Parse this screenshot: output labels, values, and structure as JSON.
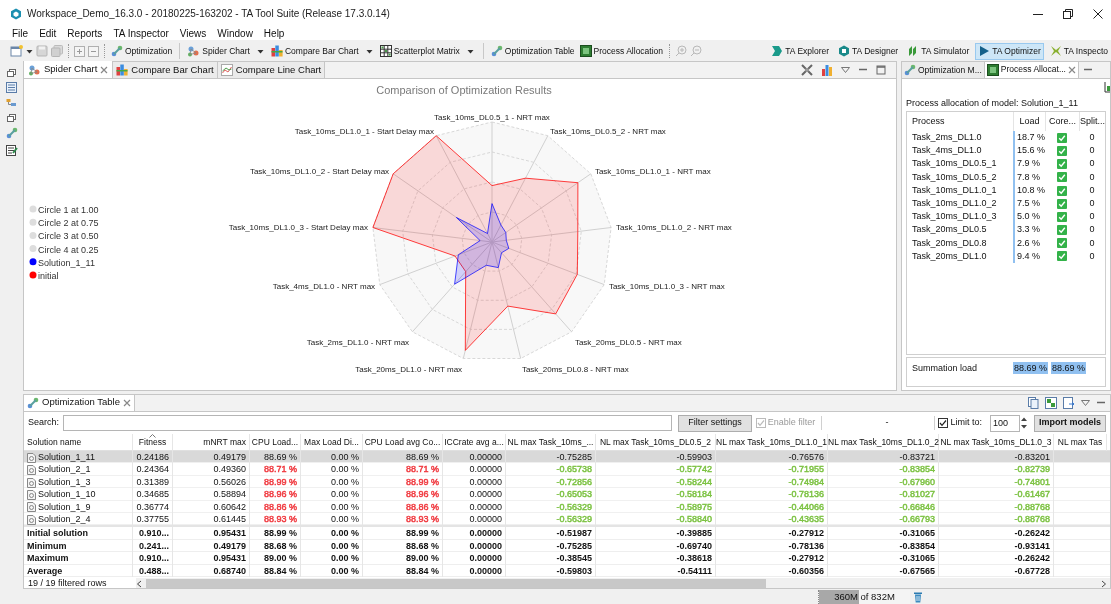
{
  "window": {
    "title": "Workspace_Demo_16.3.0 - 20180225-163202 - TA Tool Suite (Release 17.3.0.14)"
  },
  "menu": [
    "File",
    "Edit",
    "Reports",
    "TA Inspector",
    "Views",
    "Window",
    "Help"
  ],
  "toolbar": [
    {
      "label": "Optimization",
      "dropdown": false
    },
    {
      "label": "Spider Chart",
      "dropdown": true
    },
    {
      "label": "Compare Bar Chart",
      "dropdown": true
    },
    {
      "label": "Scatterplot Matrix",
      "dropdown": true
    },
    {
      "label": "Optimization Table",
      "dropdown": false
    },
    {
      "label": "Process Allocation",
      "dropdown": false
    }
  ],
  "perspectives": [
    {
      "label": "TA Explorer",
      "selected": false
    },
    {
      "label": "TA Designer",
      "selected": false
    },
    {
      "label": "TA Simulator",
      "selected": false
    },
    {
      "label": "TA Optimizer",
      "selected": true
    },
    {
      "label": "TA Inspecto",
      "selected": false
    }
  ],
  "editor": {
    "tabs": [
      {
        "label": "Spider Chart",
        "selected": true
      },
      {
        "label": "Compare Bar Chart",
        "selected": false
      },
      {
        "label": "Compare Line Chart",
        "selected": false
      }
    ],
    "chart": {
      "title": "Comparison of Optimization Results",
      "axes": [
        "Task_10ms_DL0.5_1 - NRT max",
        "Task_10ms_DL1.0_1 - Start Delay max",
        "Task_10ms_DL0.5_2 - NRT max",
        "Task_10ms_DL1.0_2 - Start Delay max",
        "Task_10ms_DL1.0_1 - NRT max",
        "Task_10ms_DL1.0_3 - Start Delay max",
        "Task_10ms_DL1.0_2 - NRT max",
        "Task_4ms_DL1.0 - NRT max",
        "Task_10ms_DL1.0_3 - NRT max",
        "Task_2ms_DL1.0 - NRT max",
        "Task_20ms_DL0.5 - NRT max",
        "Task_20ms_DL1.0 - NRT max",
        "Task_20ms_DL0.8 - NRT max"
      ],
      "legend": [
        {
          "label": "Circle 1 at 1.00",
          "color": "#dddddd"
        },
        {
          "label": "Circle 2 at 0.75",
          "color": "#dddddd"
        },
        {
          "label": "Circle 3 at 0.50",
          "color": "#dddddd"
        },
        {
          "label": "Circle 4 at 0.25",
          "color": "#dddddd"
        },
        {
          "label": "Solution_1_11",
          "color": "#0000ff"
        },
        {
          "label": "initial",
          "color": "#ff0000"
        }
      ]
    }
  },
  "process_panel": {
    "tabs": [
      {
        "label": "Optimization M...",
        "selected": false
      },
      {
        "label": "Process Allocat...",
        "selected": true
      }
    ],
    "heading": "Process allocation of model: Solution_1_11",
    "columns": [
      "Process",
      "Load",
      "Core...",
      "Split..."
    ],
    "rows": [
      {
        "process": "Task_2ms_DL1.0",
        "load": "18.7 %",
        "checked": true,
        "split": "0"
      },
      {
        "process": "Task_4ms_DL1.0",
        "load": "15.6 %",
        "checked": true,
        "split": "0"
      },
      {
        "process": "Task_10ms_DL0.5_1",
        "load": "7.9 %",
        "checked": true,
        "split": "0"
      },
      {
        "process": "Task_10ms_DL0.5_2",
        "load": "7.8 %",
        "checked": true,
        "split": "0"
      },
      {
        "process": "Task_10ms_DL1.0_1",
        "load": "10.8 %",
        "checked": true,
        "split": "0"
      },
      {
        "process": "Task_10ms_DL1.0_2",
        "load": "7.5 %",
        "checked": true,
        "split": "0"
      },
      {
        "process": "Task_10ms_DL1.0_3",
        "load": "5.0 %",
        "checked": true,
        "split": "0"
      },
      {
        "process": "Task_20ms_DL0.5",
        "load": "3.3 %",
        "checked": true,
        "split": "0"
      },
      {
        "process": "Task_20ms_DL0.8",
        "load": "2.6 %",
        "checked": true,
        "split": "0"
      },
      {
        "process": "Task_20ms_DL1.0",
        "load": "9.4 %",
        "checked": true,
        "split": "0"
      }
    ],
    "summary": {
      "label": "Summation load",
      "values": [
        "88.69 %",
        "88.69 %"
      ]
    }
  },
  "table_panel": {
    "tab": "Optimization Table",
    "search_label": "Search:",
    "filter_button": "Filter settings",
    "enable_filter": {
      "label": "Enable filter",
      "checked": true,
      "disabled": true
    },
    "filter_status": "-",
    "limit": {
      "label": "Limit to:",
      "checked": true,
      "value": "100"
    },
    "import_button": "Import models",
    "columns": [
      "Solution name",
      "Fitness",
      "mNRT max",
      "CPU Load...",
      "Max Load Di...",
      "CPU Load avg Co...",
      "ICCrate avg a...",
      "NL max Task_10ms_...",
      "NL max Task_10ms_DL0.5_2",
      "NL max Task_10ms_DL1.0_1",
      "NL max Task_10ms_DL1.0_2",
      "NL max Task_10ms_DL1.0_3",
      "NL max Tas"
    ],
    "rows": [
      {
        "selected": true,
        "cells": [
          {
            "text": "Solution_1_11"
          },
          {
            "text": "0.24186"
          },
          {
            "text": "0.49179"
          },
          {
            "text": "88.69 %"
          },
          {
            "text": "0.00 %"
          },
          {
            "text": "88.69 %"
          },
          {
            "text": "0.00000"
          },
          {
            "text": "-0.75285"
          },
          {
            "text": "-0.59903"
          },
          {
            "text": "-0.76576"
          },
          {
            "text": "-0.83721"
          },
          {
            "text": "-0.83201"
          }
        ]
      },
      {
        "selected": false,
        "cells": [
          {
            "text": "Solution_2_1"
          },
          {
            "text": "0.24364"
          },
          {
            "text": "0.49360"
          },
          {
            "text": "88.71 %",
            "color": "#f0393f"
          },
          {
            "text": "0.00 %"
          },
          {
            "text": "88.71 %",
            "color": "#f0393f"
          },
          {
            "text": "0.00000"
          },
          {
            "text": "-0.65738",
            "color": "#7cc242"
          },
          {
            "text": "-0.57742",
            "color": "#7cc242"
          },
          {
            "text": "-0.71955",
            "color": "#7cc242"
          },
          {
            "text": "-0.83854",
            "color": "#7cc242"
          },
          {
            "text": "-0.82739",
            "color": "#7cc242"
          }
        ]
      },
      {
        "selected": false,
        "cells": [
          {
            "text": "Solution_1_3"
          },
          {
            "text": "0.31389"
          },
          {
            "text": "0.56026"
          },
          {
            "text": "88.99 %",
            "color": "#f0393f"
          },
          {
            "text": "0.00 %"
          },
          {
            "text": "88.99 %",
            "color": "#f0393f"
          },
          {
            "text": "0.00000"
          },
          {
            "text": "-0.72856",
            "color": "#7cc242"
          },
          {
            "text": "-0.58244",
            "color": "#7cc242"
          },
          {
            "text": "-0.74984",
            "color": "#7cc242"
          },
          {
            "text": "-0.67960",
            "color": "#7cc242"
          },
          {
            "text": "-0.74801",
            "color": "#7cc242"
          }
        ]
      },
      {
        "selected": false,
        "cells": [
          {
            "text": "Solution_1_10"
          },
          {
            "text": "0.34685"
          },
          {
            "text": "0.58894"
          },
          {
            "text": "88.96 %",
            "color": "#f0393f"
          },
          {
            "text": "0.00 %"
          },
          {
            "text": "88.96 %",
            "color": "#f0393f"
          },
          {
            "text": "0.00000"
          },
          {
            "text": "-0.65053",
            "color": "#7cc242"
          },
          {
            "text": "-0.58184",
            "color": "#7cc242"
          },
          {
            "text": "-0.78136",
            "color": "#7cc242"
          },
          {
            "text": "-0.81027",
            "color": "#7cc242"
          },
          {
            "text": "-0.61467",
            "color": "#7cc242"
          }
        ]
      },
      {
        "selected": false,
        "cells": [
          {
            "text": "Solution_1_9"
          },
          {
            "text": "0.36774"
          },
          {
            "text": "0.60642"
          },
          {
            "text": "88.86 %",
            "color": "#f0393f"
          },
          {
            "text": "0.00 %"
          },
          {
            "text": "88.86 %",
            "color": "#f0393f"
          },
          {
            "text": "0.00000"
          },
          {
            "text": "-0.56329",
            "color": "#7cc242"
          },
          {
            "text": "-0.58975",
            "color": "#7cc242"
          },
          {
            "text": "-0.44066",
            "color": "#7cc242"
          },
          {
            "text": "-0.66846",
            "color": "#7cc242"
          },
          {
            "text": "-0.88768",
            "color": "#7cc242"
          }
        ]
      },
      {
        "selected": false,
        "cells": [
          {
            "text": "Solution_2_4"
          },
          {
            "text": "0.37755"
          },
          {
            "text": "0.61445"
          },
          {
            "text": "88.93 %",
            "color": "#f0393f"
          },
          {
            "text": "0.00 %"
          },
          {
            "text": "88.93 %",
            "color": "#f0393f"
          },
          {
            "text": "0.00000"
          },
          {
            "text": "-0.56329",
            "color": "#7cc242"
          },
          {
            "text": "-0.58840",
            "color": "#7cc242"
          },
          {
            "text": "-0.43635",
            "color": "#7cc242"
          },
          {
            "text": "-0.66793",
            "color": "#7cc242"
          },
          {
            "text": "-0.88768",
            "color": "#7cc242"
          }
        ]
      }
    ],
    "summary_rows": [
      [
        "Initial solution",
        "0.910...",
        "0.95431",
        "88.99 %",
        "0.00 %",
        "88.99 %",
        "0.00000",
        "-0.51987",
        "-0.39885",
        "-0.27912",
        "-0.31065",
        "-0.26242"
      ],
      [
        "Minimum",
        "0.241...",
        "0.49179",
        "88.68 %",
        "0.00 %",
        "88.68 %",
        "0.00000",
        "-0.75285",
        "-0.69740",
        "-0.78136",
        "-0.83854",
        "-0.93141"
      ],
      [
        "Maximum",
        "0.910...",
        "0.95431",
        "89.00 %",
        "0.00 %",
        "89.00 %",
        "0.00000",
        "-0.38545",
        "-0.38618",
        "-0.27912",
        "-0.31065",
        "-0.26242"
      ],
      [
        "Average",
        "0.488...",
        "0.68740",
        "88.84 %",
        "0.00 %",
        "88.84 %",
        "0.00000",
        "-0.59803",
        "-0.54111",
        "-0.60356",
        "-0.67565",
        "-0.67728"
      ]
    ],
    "footer": "19 / 19 filtered rows"
  },
  "status_bar": {
    "memory": {
      "text": "360M of 832M",
      "level": 0.433
    }
  }
}
